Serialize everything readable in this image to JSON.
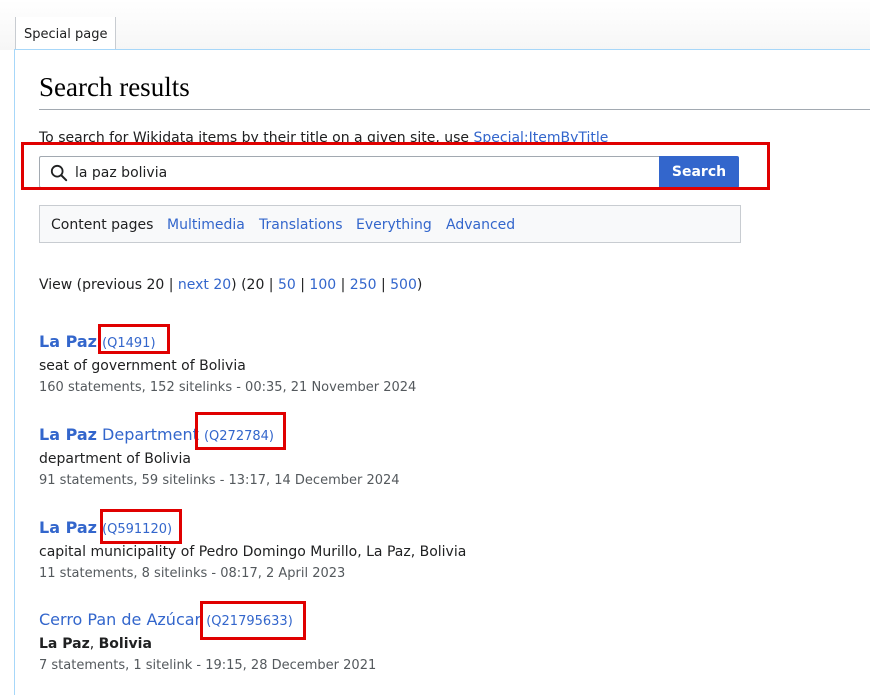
{
  "tab": {
    "label": "Special page"
  },
  "page": {
    "title": "Search results"
  },
  "notice": {
    "text": "To search for Wikidata items by their title on a given site, use ",
    "link": "Special:ItemByTitle"
  },
  "search": {
    "value": "la paz bolivia",
    "button_label": "Search"
  },
  "profiles": {
    "active": "Content pages",
    "items": [
      "Multimedia",
      "Translations",
      "Everything",
      "Advanced"
    ]
  },
  "pagination": {
    "prefix": "View (previous 20 | ",
    "next": "next 20",
    "middle": ") (20 | ",
    "sizes": [
      "50",
      "100",
      "250",
      "500"
    ],
    "suffix": ")"
  },
  "results": [
    {
      "title_bold": "La Paz",
      "title_rest": "",
      "qid": "(Q1491)",
      "description": "seat of government of Bolivia",
      "meta": "160 statements, 152 sitelinks - 00:35, 21 November 2024"
    },
    {
      "title_bold": "La Paz",
      "title_rest": " Department",
      "qid": "(Q272784)",
      "description": "department of Bolivia",
      "meta": "91 statements, 59 sitelinks - 13:17, 14 December 2024"
    },
    {
      "title_bold": "La Paz",
      "title_rest": "",
      "qid": "(Q591120)",
      "description": "capital municipality of Pedro Domingo Murillo, La Paz, Bolivia",
      "meta": "11 statements, 8 sitelinks - 08:17, 2 April 2023"
    },
    {
      "title_bold": "",
      "title_rest": "Cerro Pan de Azúcar",
      "qid": "(Q21795633)",
      "description_bold_1": "La Paz",
      "description_sep": ", ",
      "description_bold_2": "Bolivia",
      "meta": "7 statements, 1 sitelink - 19:15, 28 December 2021"
    }
  ],
  "colors": {
    "link": "#3366cc",
    "highlight_box": "#e00000",
    "button": "#3366cc"
  }
}
